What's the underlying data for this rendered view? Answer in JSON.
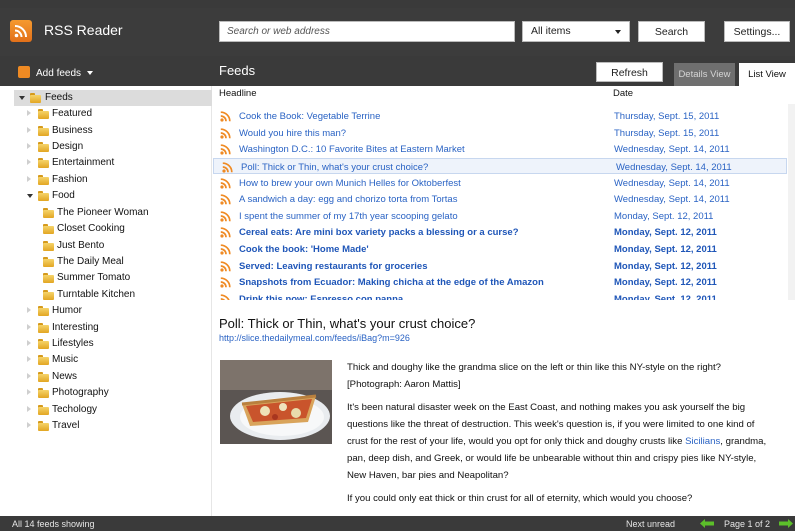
{
  "app": {
    "title": "RSS Reader"
  },
  "toolbar": {
    "search_placeholder": "Search or web address",
    "filter_value": "All items",
    "search_label": "Search",
    "settings_label": "Settings..."
  },
  "subbar": {
    "add_feeds_label": "Add feeds",
    "feeds_heading": "Feeds",
    "refresh_label": "Refresh",
    "details_view_label": "Details View",
    "list_view_label": "List View"
  },
  "sidebar": {
    "root": {
      "label": "Feeds"
    },
    "items": [
      {
        "label": "Featured"
      },
      {
        "label": "Business"
      },
      {
        "label": "Design"
      },
      {
        "label": "Entertainment"
      },
      {
        "label": "Fashion"
      },
      {
        "label": "Food"
      },
      {
        "label": "The Pioneer Woman"
      },
      {
        "label": "Closet Cooking"
      },
      {
        "label": "Just Bento"
      },
      {
        "label": "The Daily Meal"
      },
      {
        "label": "Summer Tomato"
      },
      {
        "label": "Turntable Kitchen"
      },
      {
        "label": "Humor"
      },
      {
        "label": "Interesting"
      },
      {
        "label": "Lifestyles"
      },
      {
        "label": "Music"
      },
      {
        "label": "News"
      },
      {
        "label": "Photography"
      },
      {
        "label": "Techology"
      },
      {
        "label": "Travel"
      }
    ]
  },
  "list": {
    "headline_header": "Headline",
    "date_header": "Date",
    "rows": [
      {
        "title": "Cook the Book: Vegetable Terrine",
        "date": "Thursday, Sept. 15, 2011",
        "unread": false
      },
      {
        "title": "Would you hire this man?",
        "date": "Thursday, Sept. 15, 2011",
        "unread": false
      },
      {
        "title": "Washington D.C.: 10 Favorite Bites at Eastern Market",
        "date": "Wednesday, Sept. 14, 2011",
        "unread": false
      },
      {
        "title": "Poll: Thick or Thin, what's your crust choice?",
        "date": "Wednesday, Sept. 14, 2011",
        "unread": false,
        "selected": true
      },
      {
        "title": "How to brew your own Munich Helles for Oktoberfest",
        "date": "Wednesday, Sept. 14, 2011",
        "unread": false
      },
      {
        "title": "A sandwich a day: egg and chorizo torta from Tortas",
        "date": "Wednesday, Sept. 14, 2011",
        "unread": false
      },
      {
        "title": "I spent the summer of my 17th year scooping gelato",
        "date": "Monday, Sept. 12, 2011",
        "unread": false
      },
      {
        "title": "Cereal eats: Are mini box variety packs a blessing or a curse?",
        "date": "Monday, Sept. 12, 2011",
        "unread": true
      },
      {
        "title": "Cook the book: 'Home Made'",
        "date": "Monday, Sept. 12, 2011",
        "unread": true
      },
      {
        "title": "Served: Leaving restaurants for groceries",
        "date": "Monday, Sept. 12, 2011",
        "unread": true
      },
      {
        "title": "Snapshots from Ecuador: Making chicha at the edge of the Amazon",
        "date": "Monday, Sept. 12, 2011",
        "unread": true
      },
      {
        "title": "Drink this now: Espresso con panna",
        "date": "Monday, Sept. 12, 2011",
        "unread": true
      }
    ]
  },
  "article": {
    "title": "Poll: Thick or Thin, what's your crust choice?",
    "link": "http://slice.thedailymeal.com/feeds/iBag?m=926",
    "p1": "Thick and doughy like the grandma slice on the left or thin like this NY-style on the right? [Photograph: Aaron Mattis]",
    "p2_before": "It's been natural disaster week on the East Coast, and nothing makes you ask yourself the big questions like the threat of destruction. This week's question is, if you were limited to one kind of crust for the rest of your life, would you opt for only thick and doughy crusts like ",
    "p2_link": "Sicilians",
    "p2_after": ", grandma, pan, deep dish, and Greek, or would life be unbearable without thin and crispy pies like NY-style, New Haven, bar pies and Neapolitan?",
    "p3": "If you could only eat thick or thin crust for all of eternity, which would you choose?"
  },
  "status": {
    "feeds_showing": "All 14 feeds showing",
    "next_unread": "Next unread",
    "page_info": "Page 1 of 2"
  },
  "colors": {
    "chrome": "#3a3a3a",
    "link": "#2a63c4",
    "rss_orange": "#ef8a23",
    "nav_arrow_green": "#5cbf2a"
  }
}
